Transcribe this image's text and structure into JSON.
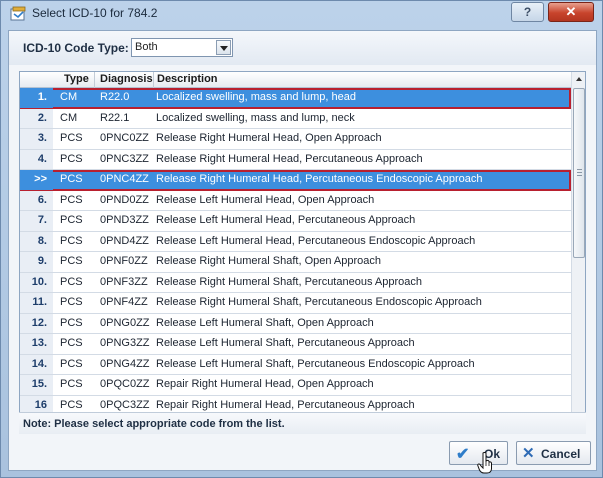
{
  "window": {
    "title": "Select ICD-10 for 784.2",
    "help_label": "?",
    "close_label": "✕"
  },
  "code_type": {
    "label": "ICD-10 Code Type:",
    "value": "Both"
  },
  "table": {
    "headers": {
      "type": "Type",
      "diagnosis": "Diagnosis",
      "description": "Description"
    },
    "rows": [
      {
        "num": "1.",
        "type": "CM",
        "diag": "R22.0",
        "desc": "Localized swelling, mass and lump, head",
        "selected": true,
        "outlined": true
      },
      {
        "num": "2.",
        "type": "CM",
        "diag": "R22.1",
        "desc": "Localized swelling, mass and lump, neck"
      },
      {
        "num": "3.",
        "type": "PCS",
        "diag": "0PNC0ZZ",
        "desc": "Release Right Humeral Head, Open Approach"
      },
      {
        "num": "4.",
        "type": "PCS",
        "diag": "0PNC3ZZ",
        "desc": "Release Right Humeral Head, Percutaneous Approach"
      },
      {
        "num": ">>",
        "type": "PCS",
        "diag": "0PNC4ZZ",
        "desc": "Release Right Humeral Head, Percutaneous Endoscopic Approach",
        "selected": true,
        "outlined": true
      },
      {
        "num": "6.",
        "type": "PCS",
        "diag": "0PND0ZZ",
        "desc": "Release Left Humeral Head, Open Approach"
      },
      {
        "num": "7.",
        "type": "PCS",
        "diag": "0PND3ZZ",
        "desc": "Release Left Humeral Head, Percutaneous Approach"
      },
      {
        "num": "8.",
        "type": "PCS",
        "diag": "0PND4ZZ",
        "desc": "Release Left Humeral Head, Percutaneous Endoscopic Approach"
      },
      {
        "num": "9.",
        "type": "PCS",
        "diag": "0PNF0ZZ",
        "desc": "Release Right Humeral Shaft, Open Approach"
      },
      {
        "num": "10.",
        "type": "PCS",
        "diag": "0PNF3ZZ",
        "desc": "Release Right Humeral Shaft, Percutaneous Approach"
      },
      {
        "num": "11.",
        "type": "PCS",
        "diag": "0PNF4ZZ",
        "desc": "Release Right Humeral Shaft, Percutaneous Endoscopic Approach"
      },
      {
        "num": "12.",
        "type": "PCS",
        "diag": "0PNG0ZZ",
        "desc": "Release Left Humeral Shaft, Open Approach"
      },
      {
        "num": "13.",
        "type": "PCS",
        "diag": "0PNG3ZZ",
        "desc": "Release Left Humeral Shaft, Percutaneous Approach"
      },
      {
        "num": "14.",
        "type": "PCS",
        "diag": "0PNG4ZZ",
        "desc": "Release Left Humeral Shaft, Percutaneous Endoscopic Approach"
      },
      {
        "num": "15.",
        "type": "PCS",
        "diag": "0PQC0ZZ",
        "desc": "Repair Right Humeral Head, Open Approach"
      },
      {
        "num": "16",
        "type": "PCS",
        "diag": "0PQC3ZZ",
        "desc": "Repair Right Humeral Head, Percutaneous Approach"
      }
    ]
  },
  "note": "Note: Please select appropriate code from the list.",
  "buttons": {
    "ok": "Ok",
    "cancel": "Cancel"
  },
  "icons": {
    "app": "application-icon",
    "ok": "checkmark-icon",
    "cancel": "x-icon",
    "cursor": "hand-pointer-icon"
  },
  "colors": {
    "selection": "#3d8fde",
    "outline": "#b8202f",
    "close": "#c8442c"
  }
}
